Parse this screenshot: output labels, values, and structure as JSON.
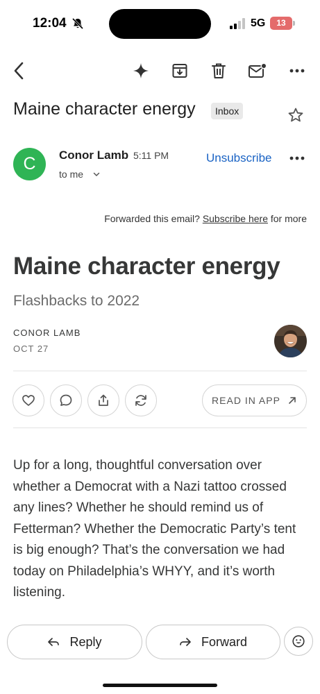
{
  "status_bar": {
    "time": "12:04",
    "network": "5G",
    "battery": "13"
  },
  "email": {
    "subject": "Maine character energy",
    "label_chip": "Inbox",
    "sender": {
      "initial": "C",
      "name": "Conor Lamb",
      "time": "5:11 PM",
      "recipient": "to me"
    },
    "unsubscribe_label": "Unsubscribe",
    "forwarded": {
      "prefix": "Forwarded this email?",
      "link": "Subscribe here",
      "suffix": "for more"
    }
  },
  "post": {
    "title": "Maine character energy",
    "subtitle": "Flashbacks to 2022",
    "author": "CONOR LAMB",
    "date": "OCT 27",
    "read_in_app": "READ IN APP",
    "body": "Up for a long, thoughtful conversation over whether a Democrat with a Nazi tattoo crossed any lines? Whether he should remind us of Fetterman? Whether the Democratic Party’s tent is big enough? That’s the conversation we had today on Philadelphia’s WHYY, and it’s worth listening."
  },
  "actions": {
    "reply": "Reply",
    "forward": "Forward"
  },
  "colors": {
    "avatar_green": "#2fb455",
    "link_blue": "#1a63c4",
    "battery_red": "#e46b6b"
  },
  "icons": [
    "back-arrow-icon",
    "sparkle-icon",
    "archive-icon",
    "trash-icon",
    "mail-unread-icon",
    "more-icon",
    "star-icon",
    "chevron-down-icon",
    "heart-icon",
    "comment-icon",
    "share-icon",
    "restack-icon",
    "arrow-up-right-icon",
    "reply-icon",
    "forward-icon",
    "emoji-icon",
    "bell-off-icon",
    "signal-icon"
  ]
}
